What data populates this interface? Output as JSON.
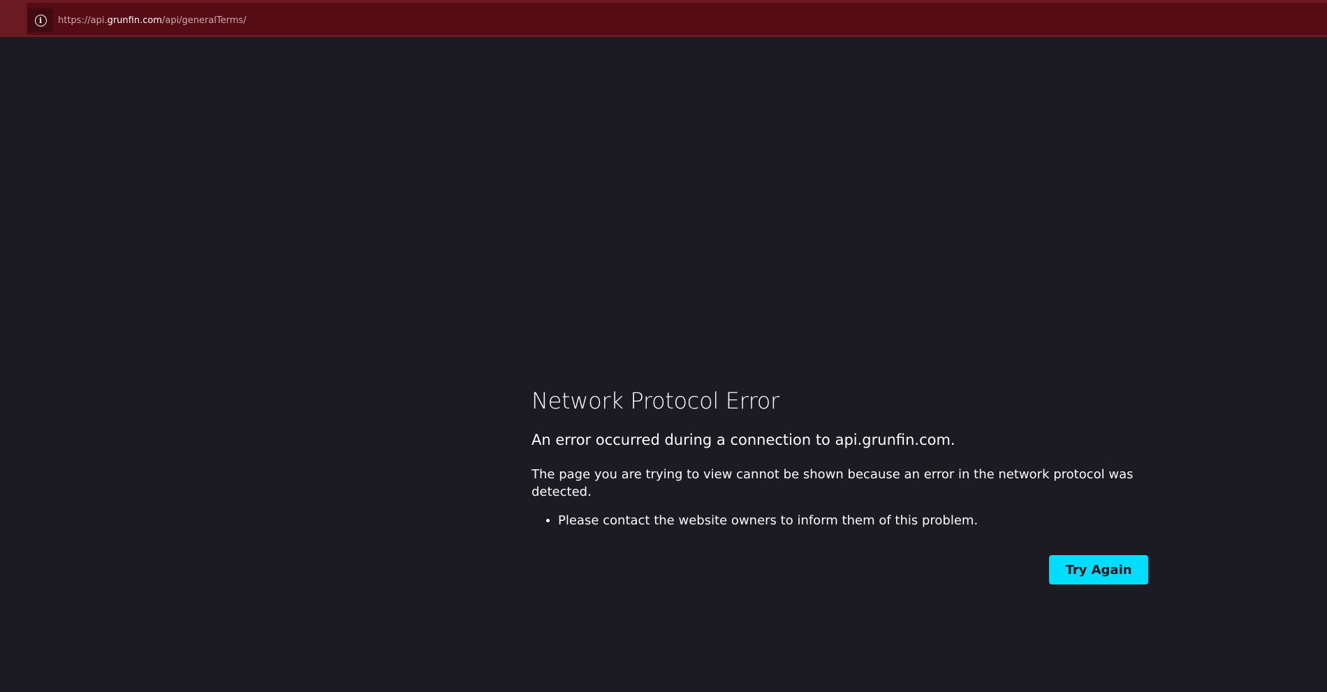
{
  "toolbar": {
    "url_prefix": "https://api.",
    "url_host": "grunfin.com",
    "url_path": "/api/generalTerms/",
    "info_icon": "info-icon",
    "accent_color": "#560c14"
  },
  "error": {
    "title": "Network Protocol Error",
    "subtitle": "An error occurred during a connection to api.grunfin.com.",
    "description": "The page you are trying to view cannot be shown because an error in the network protocol was detected.",
    "bullets": [
      "Please contact the website owners to inform them of this problem."
    ],
    "button_label": "Try Again",
    "button_color": "#00ddff",
    "background_color": "#1c1b22"
  }
}
